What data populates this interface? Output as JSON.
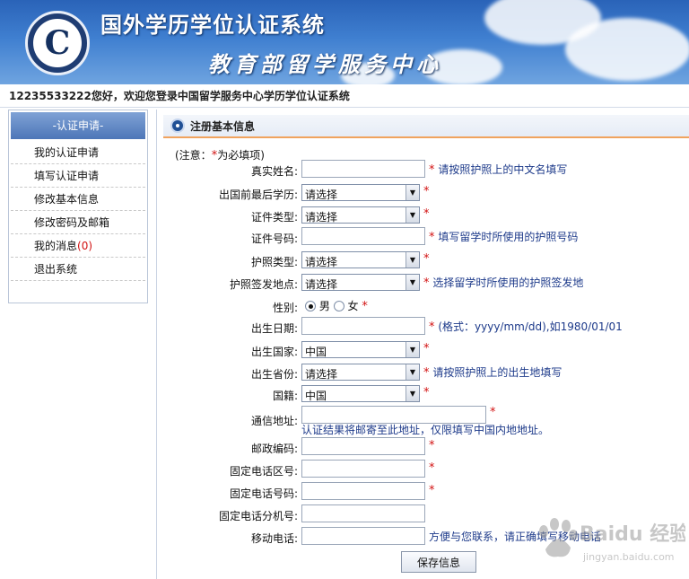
{
  "header": {
    "title": "国外学历学位认证系统",
    "subtitle": "教育部留学服务中心"
  },
  "welcome": "12235533222您好，欢迎您登录中国留学服务中心学历学位认证系统",
  "sidebar": {
    "heading": "-认证申请-",
    "items": [
      {
        "label": "我的认证申请"
      },
      {
        "label": "填写认证申请"
      },
      {
        "label": "修改基本信息"
      },
      {
        "label": "修改密码及邮箱"
      },
      {
        "label": "我的消息",
        "count": "(0)"
      },
      {
        "label": "退出系统"
      }
    ]
  },
  "section": {
    "title": "注册基本信息"
  },
  "note": {
    "prefix": "(注意：",
    "suffix": "为必填项)"
  },
  "required_mark": "*",
  "form": {
    "real_name": {
      "label": "真实姓名:",
      "value": "",
      "hint": "请按照护照上的中文名填写"
    },
    "last_degree": {
      "label": "出国前最后学历:",
      "value": "请选择"
    },
    "id_type": {
      "label": "证件类型:",
      "value": "请选择"
    },
    "id_number": {
      "label": "证件号码:",
      "value": "",
      "hint": "填写留学时所使用的护照号码"
    },
    "passport_type": {
      "label": "护照类型:",
      "value": "请选择"
    },
    "passport_place": {
      "label": "护照签发地点:",
      "value": "请选择",
      "hint": "选择留学时所使用的护照签发地"
    },
    "gender": {
      "label": "性别:",
      "options": [
        "男",
        "女"
      ],
      "selected": "男"
    },
    "birth_date": {
      "label": "出生日期:",
      "value": "",
      "hint": "(格式：yyyy/mm/dd),如1980/01/01"
    },
    "birth_country": {
      "label": "出生国家:",
      "value": "中国"
    },
    "birth_province": {
      "label": "出生省份:",
      "value": "请选择",
      "hint": "请按照护照上的出生地填写"
    },
    "nationality": {
      "label": "国籍:",
      "value": "中国"
    },
    "address": {
      "label": "通信地址:",
      "value": "",
      "hint": "认证结果将邮寄至此地址，仅限填写中国内地地址。"
    },
    "postcode": {
      "label": "邮政编码:",
      "value": ""
    },
    "area_code": {
      "label": "固定电话区号:",
      "value": ""
    },
    "phone": {
      "label": "固定电话号码:",
      "value": ""
    },
    "extension": {
      "label": "固定电话分机号:",
      "value": ""
    },
    "mobile": {
      "label": "移动电话:",
      "value": "",
      "hint": "方便与您联系，请正确填写移动电话"
    }
  },
  "save_label": "保存信息",
  "watermark": {
    "text": "Baidu 经验",
    "url": "jingyan.baidu.com"
  },
  "colors": {
    "required": "#d21212",
    "hint": "#1d3a8a",
    "accent": "#f0a35e",
    "banner": "#3f7fd0"
  }
}
